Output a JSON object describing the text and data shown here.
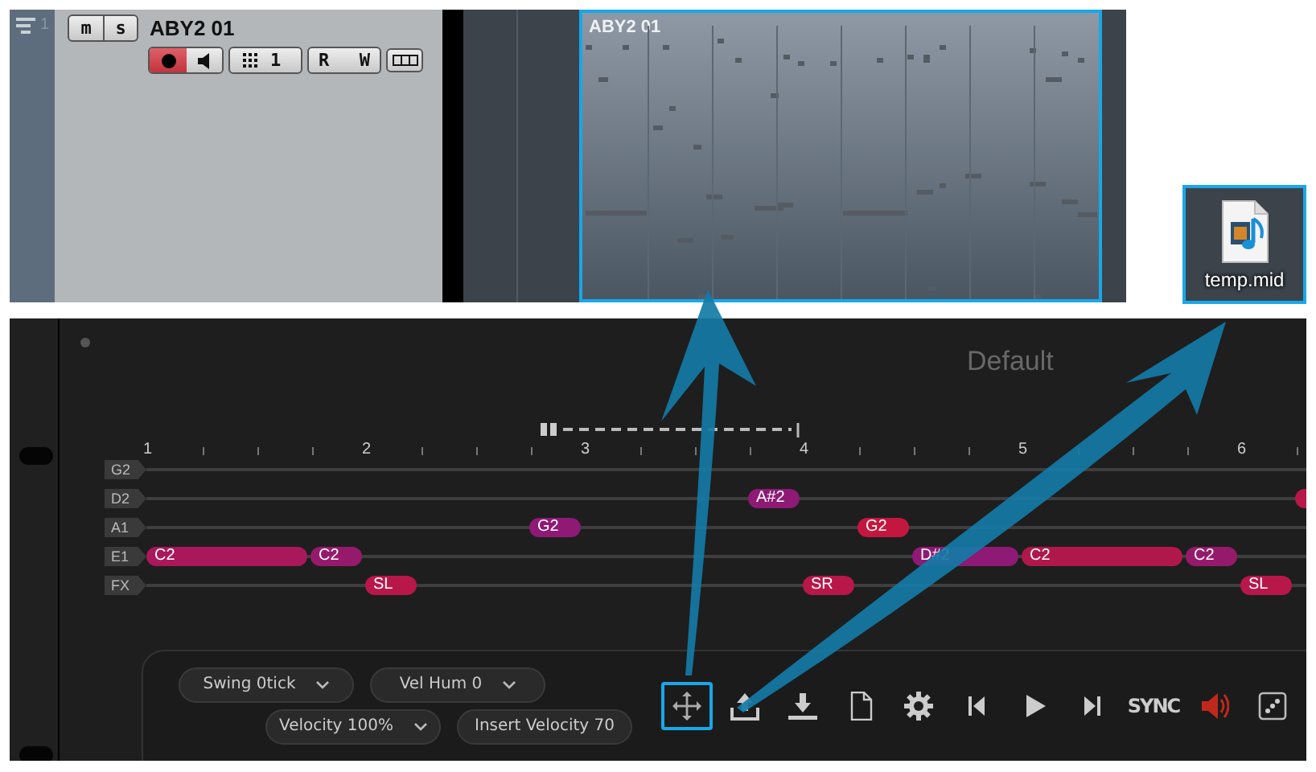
{
  "track": {
    "number": "1",
    "mute": "m",
    "solo": "s",
    "name": "ABY2 01",
    "record_armed": true,
    "input": "1",
    "read": "R",
    "write": "W"
  },
  "clip": {
    "title": "ABY2 01",
    "selected": true
  },
  "desktop_file": {
    "label": "temp.mid",
    "selected": true
  },
  "plugin": {
    "preset": "Default",
    "bars": [
      "1",
      "2",
      "3",
      "4",
      "5",
      "6"
    ],
    "lanes": [
      {
        "label": "G2"
      },
      {
        "label": "D2",
        "notes": [
          {
            "label": "A#2",
            "color": "#8e1a75"
          },
          {
            "color": "#b8174a"
          }
        ]
      },
      {
        "label": "A1",
        "notes": [
          {
            "label": "G2",
            "color": "#8e1a75"
          },
          {
            "label": "G2",
            "color": "#c4173f"
          }
        ]
      },
      {
        "label": "E1",
        "notes": [
          {
            "label": "C2",
            "color": "#a8185a"
          },
          {
            "label": "C2",
            "color": "#961a6c"
          },
          {
            "label": "D#2",
            "color": "#8e1a75"
          },
          {
            "label": "C2",
            "color": "#b0184c"
          },
          {
            "label": "C2",
            "color": "#961a6c"
          }
        ]
      },
      {
        "label": "FX",
        "notes": [
          {
            "label": "SL",
            "color": "#b8174a"
          },
          {
            "label": "SR",
            "color": "#b8174a"
          },
          {
            "label": "SL",
            "color": "#b8174a"
          }
        ]
      }
    ],
    "dropdowns": [
      {
        "label": "Swing 0tick",
        "kind": "dropdown"
      },
      {
        "label": "Vel Hum 0",
        "kind": "dropdown"
      },
      {
        "label": "Velocity 100%",
        "kind": "dropdown"
      },
      {
        "label": "Insert Velocity 70",
        "kind": "button"
      }
    ],
    "toolbar": [
      {
        "kind": "move",
        "selected": true
      },
      {
        "kind": "export",
        "selected": false
      },
      {
        "kind": "import",
        "selected": false
      },
      {
        "kind": "file",
        "selected": false
      },
      {
        "kind": "gear",
        "selected": false
      },
      {
        "kind": "prev",
        "selected": false
      },
      {
        "kind": "play",
        "selected": false
      },
      {
        "kind": "next",
        "selected": false
      },
      {
        "kind": "text",
        "label": "SYNC",
        "selected": false
      },
      {
        "kind": "speaker",
        "selected": false
      },
      {
        "kind": "dice",
        "selected": false
      }
    ]
  }
}
